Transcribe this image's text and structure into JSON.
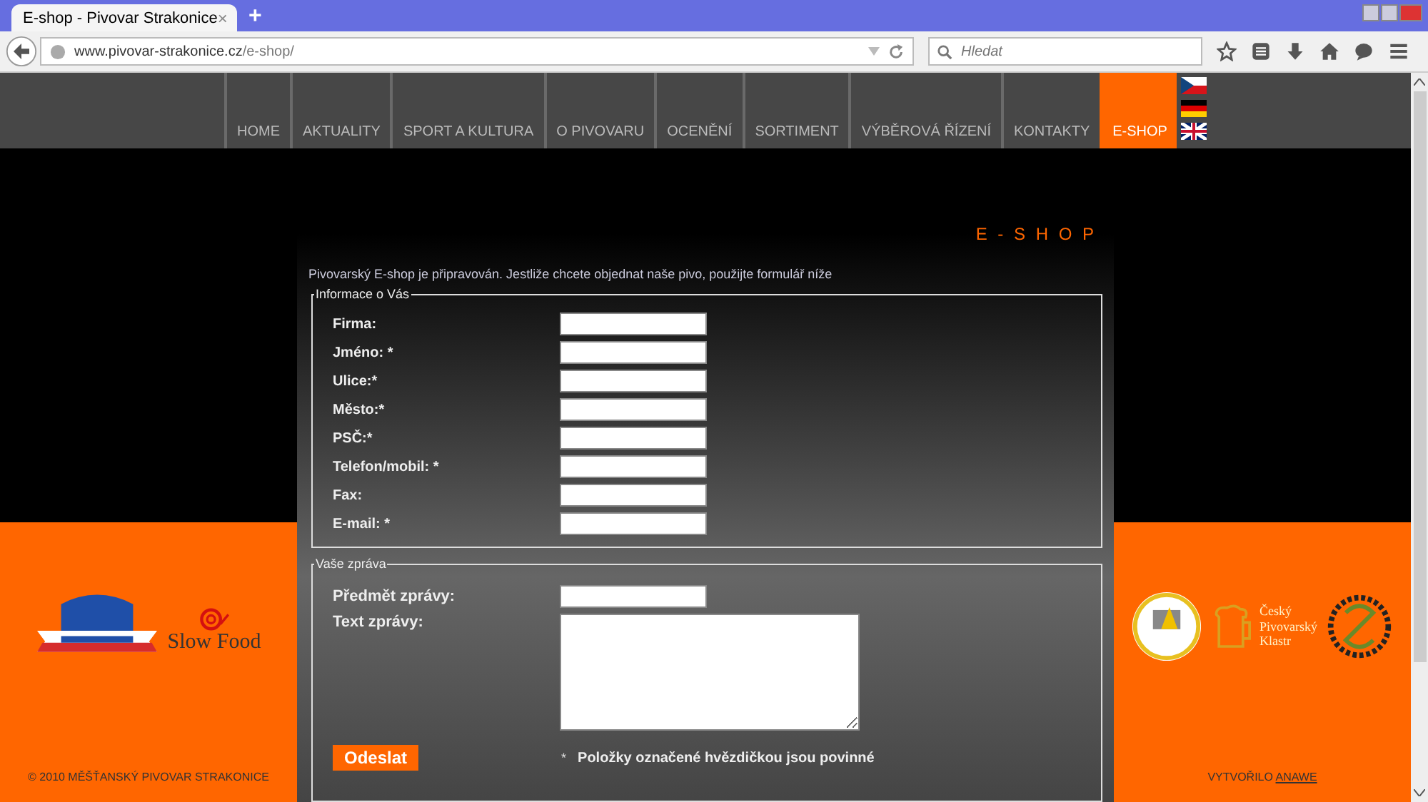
{
  "browser": {
    "tab_title": "E-shop - Pivovar Strakonice",
    "tab_close": "×",
    "new_tab": "+",
    "url_host": "www.pivovar-strakonice.cz",
    "url_path": "/e-shop/",
    "search": {
      "placeholder": "Hledat"
    }
  },
  "nav": [
    {
      "label": "HOME",
      "selected": false
    },
    {
      "label": "AKTUALITY",
      "selected": false
    },
    {
      "label": "SPORT A KULTURA",
      "selected": false
    },
    {
      "label": "O PIVOVARU",
      "selected": false
    },
    {
      "label": "OCENĚNÍ",
      "selected": false
    },
    {
      "label": "SORTIMENT",
      "selected": false
    },
    {
      "label": "VÝBĚROVÁ ŘÍZENÍ",
      "selected": false
    },
    {
      "label": "KONTAKTY",
      "selected": false
    },
    {
      "label": "E-SHOP",
      "selected": true
    }
  ],
  "heading": "E - S H O P",
  "intro": "Pivovarský E-shop je připravován. Jestliže chcete objednat naše pivo, použijte formulář níže",
  "about": {
    "legend": "Informace o Vás",
    "fields": [
      {
        "label": "Firma:"
      },
      {
        "label": "Jméno: *"
      },
      {
        "label": "Ulice:*"
      },
      {
        "label": "Město:*"
      },
      {
        "label": "PSČ:*"
      },
      {
        "label": "Telefon/mobil: *"
      },
      {
        "label": "Fax:"
      },
      {
        "label": "E-mail: *"
      }
    ]
  },
  "message": {
    "legend": "Vaše zpráva",
    "subject_label": "Předmět zprávy:",
    "text_label": "Text zprávy:",
    "send": "Odeslat",
    "note_mark": "*",
    "note": "Položky označené hvězdičkou jsou povinné"
  },
  "left_logos": {
    "slow_food": "Slow Food"
  },
  "right_logos": {
    "cluster": "Český Pivovarský Klastr"
  },
  "copyright": "© 2010 MĚŠŤANSKÝ PIVOVAR STRAKONICE",
  "credit": {
    "text": "VYTVOŘILO",
    "link": "ANAWE"
  }
}
